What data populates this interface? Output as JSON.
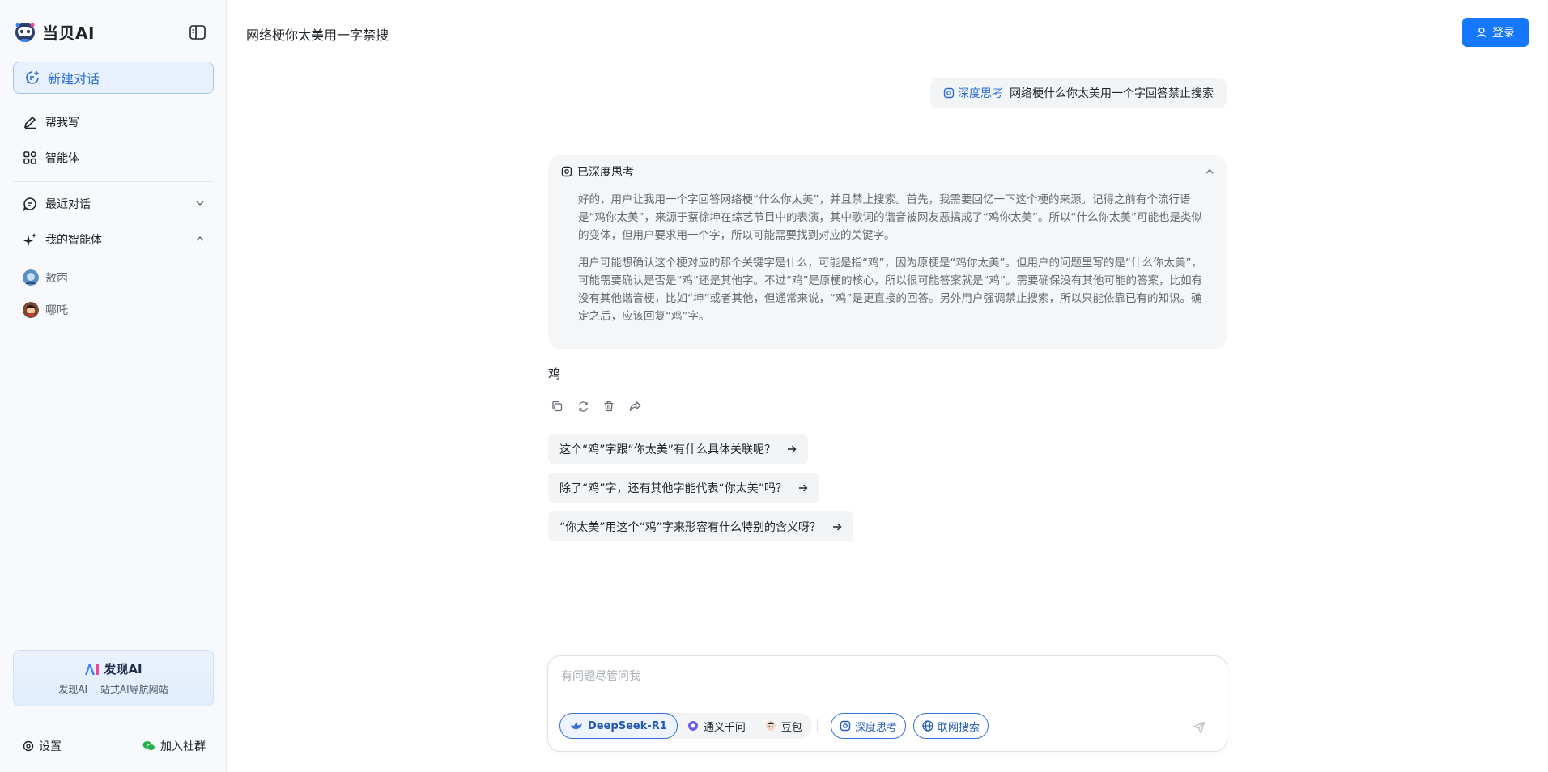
{
  "brand": {
    "name": "当贝AI"
  },
  "sidebar": {
    "new_chat": "新建对话",
    "items": [
      {
        "label": "帮我写"
      },
      {
        "label": "智能体"
      }
    ],
    "recent": "最近对话",
    "my_agents": "我的智能体",
    "agents": [
      {
        "name": "敖丙"
      },
      {
        "name": "哪吒"
      }
    ],
    "promo": {
      "logo_text": "发现AI",
      "subtitle": "发现AI 一站式AI导航网站"
    },
    "settings": "设置",
    "join_group": "加入社群"
  },
  "header": {
    "title": "网络梗你太美用一字禁搜",
    "login": "登录"
  },
  "chat": {
    "user_message": {
      "tag": "深度思考",
      "text": "网络梗什么你太美用一个字回答禁止搜索"
    },
    "thinking": {
      "title": "已深度思考",
      "paragraphs": [
        "好的，用户让我用一个字回答网络梗“什么你太美”，并且禁止搜索。首先，我需要回忆一下这个梗的来源。记得之前有个流行语是“鸡你太美”，来源于蔡徐坤在综艺节目中的表演，其中歌词的谐音被网友恶搞成了“鸡你太美”。所以“什么你太美”可能也是类似的变体，但用户要求用一个字，所以可能需要找到对应的关键字。",
        "用户可能想确认这个梗对应的那个关键字是什么，可能是指“鸡”，因为原梗是“鸡你太美”。但用户的问题里写的是“什么你太美”，可能需要确认是否是“鸡”还是其他字。不过“鸡”是原梗的核心，所以很可能答案就是“鸡”。需要确保没有其他可能的答案，比如有没有其他谐音梗，比如“坤”或者其他，但通常来说，“鸡”是更直接的回答。另外用户强调禁止搜索，所以只能依靠已有的知识。确定之后，应该回复“鸡”字。"
      ]
    },
    "answer": "鸡",
    "suggestions": [
      "这个“鸡”字跟“你太美”有什么具体关联呢？",
      "除了“鸡”字，还有其他字能代表“你太美”吗？",
      "“你太美”用这个“鸡”字来形容有什么特别的含义呀？"
    ]
  },
  "composer": {
    "placeholder": "有问题尽管问我",
    "models": [
      {
        "name": "DeepSeek-R1"
      },
      {
        "name": "通义千问"
      },
      {
        "name": "豆包"
      }
    ],
    "deep_think": "深度思考",
    "web_search": "联网搜索"
  },
  "colors": {
    "accent": "#1677ff",
    "sidebar_bg": "#f7f9fc"
  }
}
